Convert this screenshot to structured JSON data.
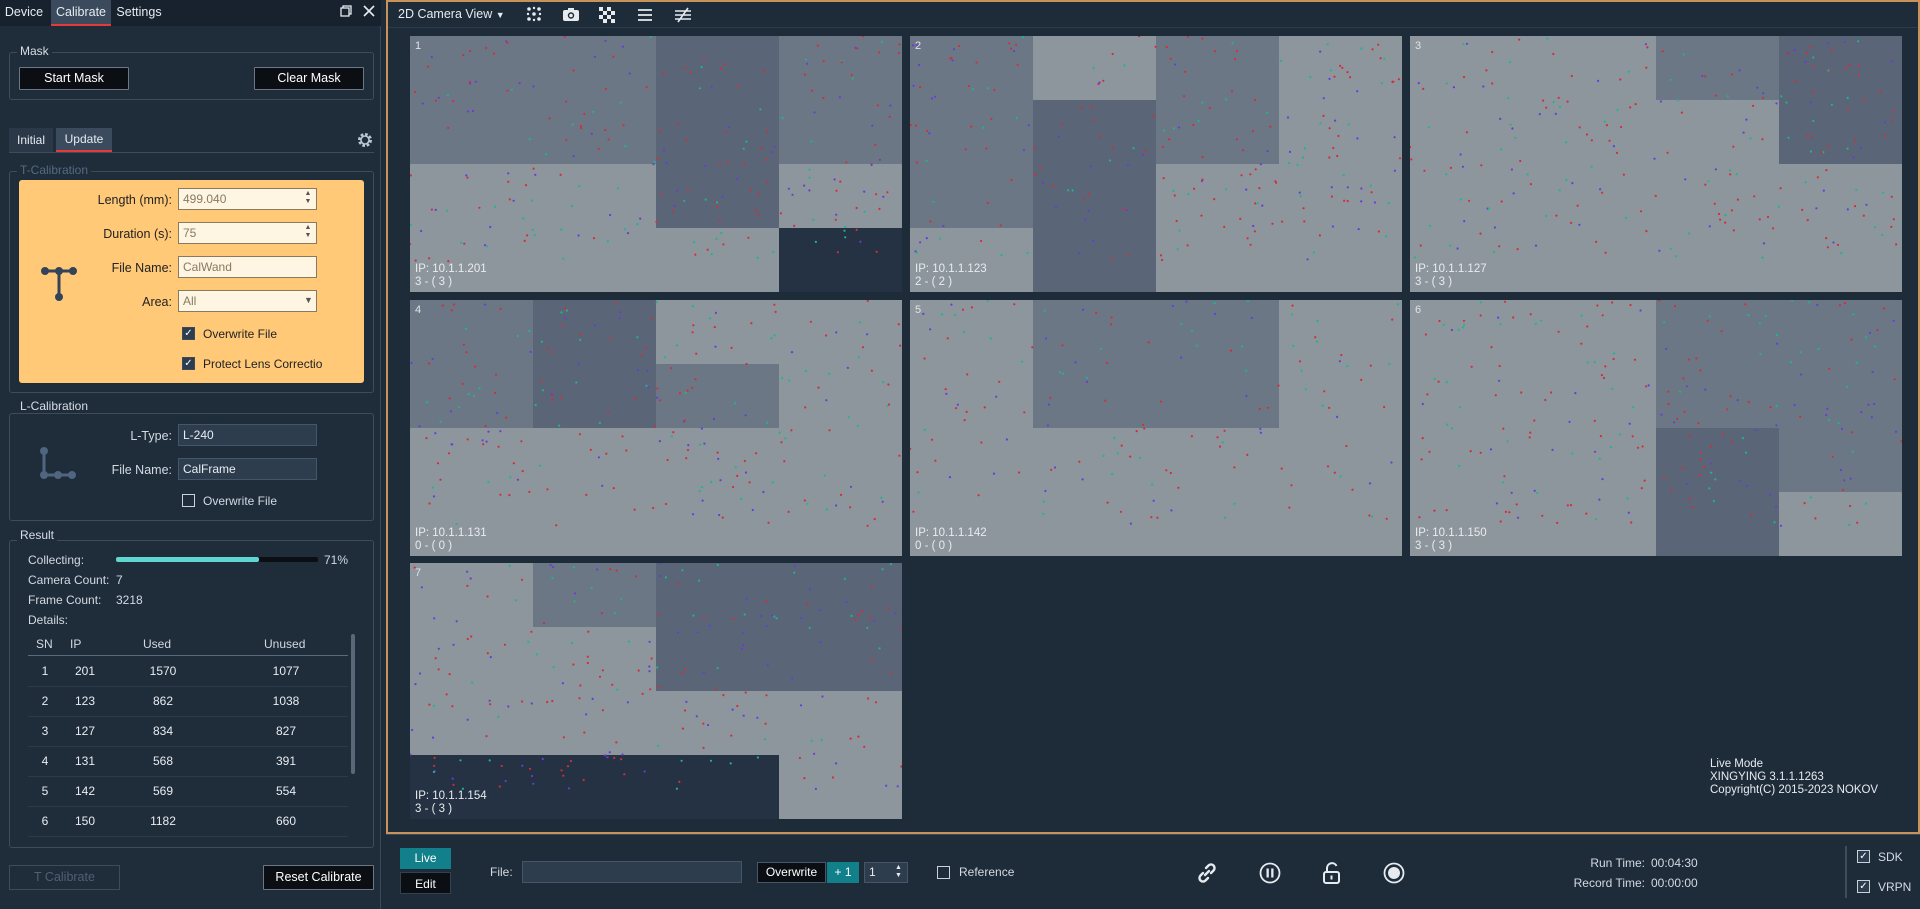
{
  "tabs": [
    "Device",
    "Calibrate",
    "Settings"
  ],
  "mask": {
    "title": "Mask",
    "start": "Start Mask",
    "clear": "Clear Mask"
  },
  "subtabs": [
    "Initial",
    "Update"
  ],
  "tcal": {
    "title": "T-Calibration",
    "length_label": "Length (mm):",
    "length": "499.040",
    "duration_label": "Duration (s):",
    "duration": "75",
    "file_label": "File Name:",
    "file": "CalWand",
    "area_label": "Area:",
    "area": "All",
    "overwrite": "Overwrite File",
    "protect": "Protect Lens Correctio"
  },
  "lcal": {
    "title": "L-Calibration",
    "ltype_label": "L-Type:",
    "ltype": "L-240",
    "file_label": "File Name:",
    "file": "CalFrame",
    "overwrite": "Overwrite File"
  },
  "result": {
    "title": "Result",
    "collecting_label": "Collecting:",
    "collecting_pct": "71%",
    "collecting_value": 0.71,
    "camera_count_label": "Camera Count:",
    "camera_count": "7",
    "frame_count_label": "Frame Count:",
    "frame_count": "3218",
    "details_label": "Details:",
    "headers": [
      "SN",
      "IP",
      "Used",
      "Unused"
    ],
    "rows": [
      [
        "1",
        "201",
        "1570",
        "1077"
      ],
      [
        "2",
        "123",
        "862",
        "1038"
      ],
      [
        "3",
        "127",
        "834",
        "827"
      ],
      [
        "4",
        "131",
        "568",
        "391"
      ],
      [
        "5",
        "142",
        "569",
        "554"
      ],
      [
        "6",
        "150",
        "1182",
        "660"
      ]
    ]
  },
  "buttons": {
    "t_calibrate": "T Calibrate",
    "reset": "Reset Calibrate"
  },
  "view": {
    "title": "2D Camera View"
  },
  "cameras": [
    {
      "num": "1",
      "ip": "IP: 10.1.1.201",
      "count": "3 - ( 3 )"
    },
    {
      "num": "2",
      "ip": "IP: 10.1.1.123",
      "count": "2 - ( 2 )"
    },
    {
      "num": "3",
      "ip": "IP: 10.1.1.127",
      "count": "3 - ( 3 )"
    },
    {
      "num": "4",
      "ip": "IP: 10.1.1.131",
      "count": "0 - ( 0 )"
    },
    {
      "num": "5",
      "ip": "IP: 10.1.1.142",
      "count": "0 - ( 0 )"
    },
    {
      "num": "6",
      "ip": "IP: 10.1.1.150",
      "count": "3 - ( 3 )"
    },
    {
      "num": "7",
      "ip": "IP: 10.1.1.154",
      "count": "3 - ( 3 )"
    }
  ],
  "info": {
    "mode": "Live Mode",
    "version": "XINGYING 3.1.1.1263",
    "copyright": "Copyright(C) 2015-2023 NOKOV"
  },
  "bottom": {
    "live": "Live",
    "edit": "Edit",
    "file_label": "File:",
    "overwrite": "Overwrite",
    "plus": "+ 1",
    "step": "1",
    "reference": "Reference",
    "run_label": "Run Time:",
    "run": "00:04:30",
    "record_label": "Record Time:",
    "record": "00:00:00",
    "sdk": "SDK",
    "vrpn": "VRPN"
  },
  "colors": {
    "accent": "#c8935a",
    "highlight": "#ffc978",
    "progress": "#5fd6d0",
    "live": "#12808a"
  }
}
